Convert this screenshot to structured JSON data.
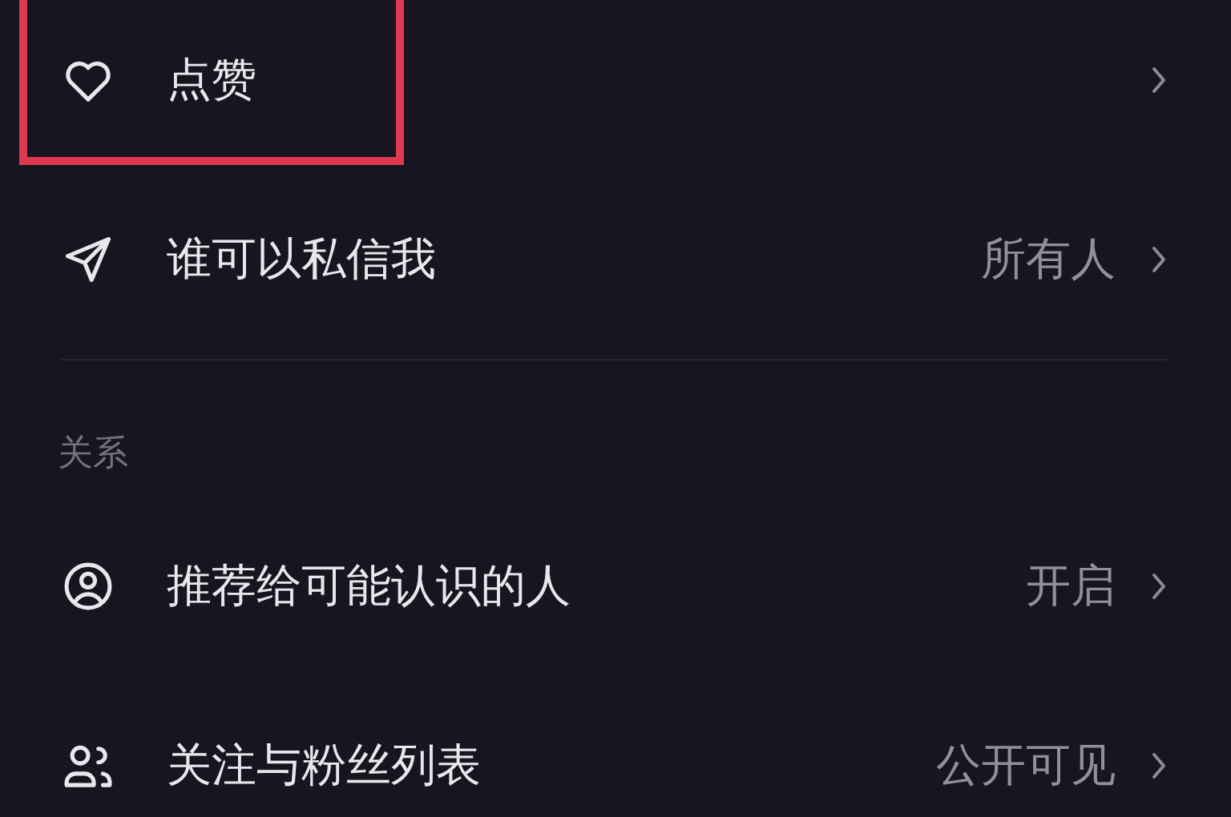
{
  "sections": [
    {
      "items": [
        {
          "kind": "heart",
          "label": "点赞",
          "highlighted": true
        },
        {
          "kind": "send",
          "label": "谁可以私信我",
          "value": "所有人",
          "highlighted": false
        }
      ]
    },
    {
      "title": "关系",
      "items": [
        {
          "kind": "person",
          "label": "推荐给可能认识的人",
          "value": "开启",
          "highlighted": false
        },
        {
          "kind": "people",
          "label": "关注与粉丝列表",
          "value": "公开可见",
          "highlighted": false
        }
      ]
    }
  ]
}
